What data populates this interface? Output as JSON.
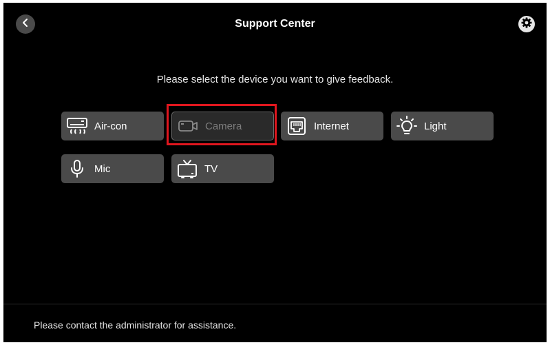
{
  "header": {
    "title": "Support Center",
    "back_icon": "chevron-left-icon",
    "settings_icon": "gear-icon"
  },
  "prompt": "Please select the device you want to give feedback.",
  "devices": [
    {
      "label": "Air-con",
      "icon": "air-conditioner-icon",
      "state": "enabled"
    },
    {
      "label": "Camera",
      "icon": "camera-icon",
      "state": "disabled"
    },
    {
      "label": "Internet",
      "icon": "network-port-icon",
      "state": "enabled"
    },
    {
      "label": "Light",
      "icon": "light-bulb-icon",
      "state": "enabled"
    },
    {
      "label": "Mic",
      "icon": "microphone-icon",
      "state": "enabled"
    },
    {
      "label": "TV",
      "icon": "tv-icon",
      "state": "enabled"
    }
  ],
  "footer": {
    "text": "Please contact the administrator for assistance."
  },
  "colors": {
    "background": "#000000",
    "button": "#4a4a4a",
    "highlight": "#e0161e"
  }
}
